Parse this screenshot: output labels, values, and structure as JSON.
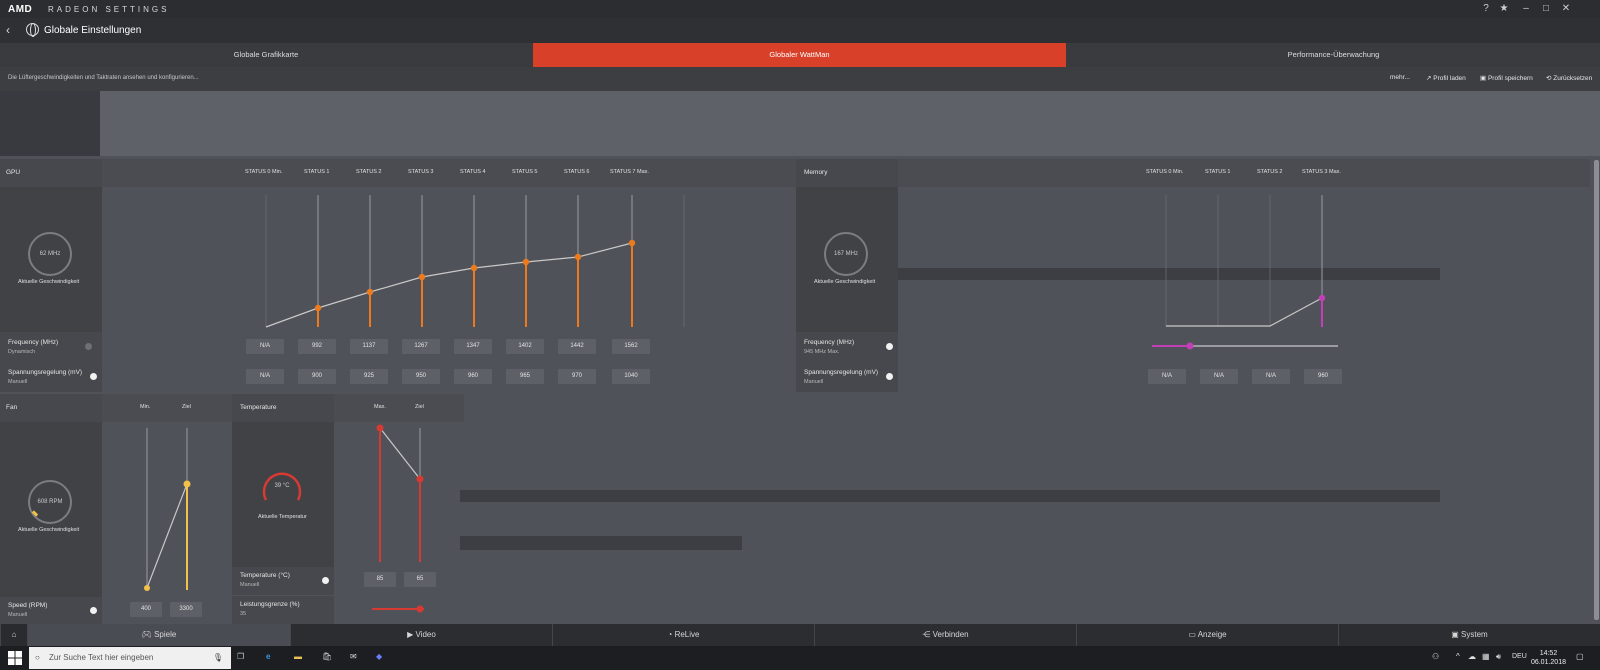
{
  "titlebar": {
    "logo": "AMD",
    "app_name": "RADEON SETTINGS",
    "help": "?",
    "star": "★",
    "minimize": "–",
    "maximize": "□",
    "close": "✕"
  },
  "nav": {
    "back": "‹",
    "title": "Globale Einstellungen"
  },
  "tabs": [
    {
      "label": "Globale Grafikkarte"
    },
    {
      "label": "Globaler WattMan"
    },
    {
      "label": "Performance-Überwachung"
    }
  ],
  "subbar": {
    "description": "Die Lüftergeschwindigkeiten und Taktraten ansehen und konfigurieren...",
    "more": "mehr...",
    "load_profile": "Profil laden",
    "save_profile": "Profil speichern",
    "reset": "Zurücksetzen"
  },
  "gpu": {
    "section": "GPU",
    "states": [
      "STATUS 0 Min.",
      "STATUS 1",
      "STATUS 2",
      "STATUS 3",
      "STATUS 4",
      "STATUS 5",
      "STATUS 6",
      "STATUS 7 Max."
    ],
    "gauge_value": "62 MHz",
    "gauge_label": "Aktuelle Geschwindigkeit",
    "frequency_label": "Frequency (MHz)",
    "frequency_mode": "Dynamisch",
    "frequency_values": [
      "N/A",
      "992",
      "1137",
      "1267",
      "1347",
      "1402",
      "1442",
      "1562"
    ],
    "voltage_label": "Spannungsregelung (mV)",
    "voltage_mode": "Manuell",
    "voltage_values": [
      "N/A",
      "900",
      "925",
      "950",
      "960",
      "965",
      "970",
      "1040"
    ]
  },
  "memory": {
    "section": "Memory",
    "states": [
      "STATUS 0 Min.",
      "STATUS 1",
      "STATUS 2",
      "STATUS 3 Max."
    ],
    "gauge_value": "167 MHz",
    "gauge_label": "Aktuelle Geschwindigkeit",
    "frequency_label": "Frequency (MHz)",
    "frequency_mode": "945 MHz Max.",
    "voltage_label": "Spannungsregelung (mV)",
    "voltage_mode": "Manuell",
    "voltage_values": [
      "N/A",
      "N/A",
      "N/A",
      "960"
    ]
  },
  "fan": {
    "section": "Fan",
    "col_min": "Min.",
    "col_target": "Ziel",
    "gauge_value": "608 RPM",
    "gauge_label": "Aktuelle Geschwindigkeit",
    "speed_label": "Speed (RPM)",
    "speed_mode": "Manuell",
    "speed_values": [
      "400",
      "3300"
    ]
  },
  "temperature": {
    "section": "Temperature",
    "col_max": "Max.",
    "col_target": "Ziel",
    "gauge_value": "39 °C",
    "gauge_label": "Aktuelle Temperatur",
    "temp_label": "Temperature (°C)",
    "temp_mode": "Manuell",
    "temp_values": [
      "85",
      "65"
    ],
    "power_label": "Leistungsgrenze (%)",
    "power_value": "35"
  },
  "bottom_nav": [
    {
      "label": "Spiele",
      "icon": "gamepad-icon"
    },
    {
      "label": "Video",
      "icon": "play-icon"
    },
    {
      "label": "ReLive",
      "icon": "relive-icon"
    },
    {
      "label": "Verbinden",
      "icon": "share-icon"
    },
    {
      "label": "Anzeige",
      "icon": "monitor-icon"
    },
    {
      "label": "System",
      "icon": "system-icon"
    }
  ],
  "taskbar": {
    "search_placeholder": "Zur Suche Text hier eingeben",
    "language": "DEU",
    "time": "14:52",
    "date": "06.01.2018"
  },
  "colors": {
    "accent": "#d8402a",
    "gpu_line": "#ee7a1e",
    "memory_line": "#c23fb8",
    "fan_line": "#f2c14a",
    "temp_line": "#d63a32"
  }
}
